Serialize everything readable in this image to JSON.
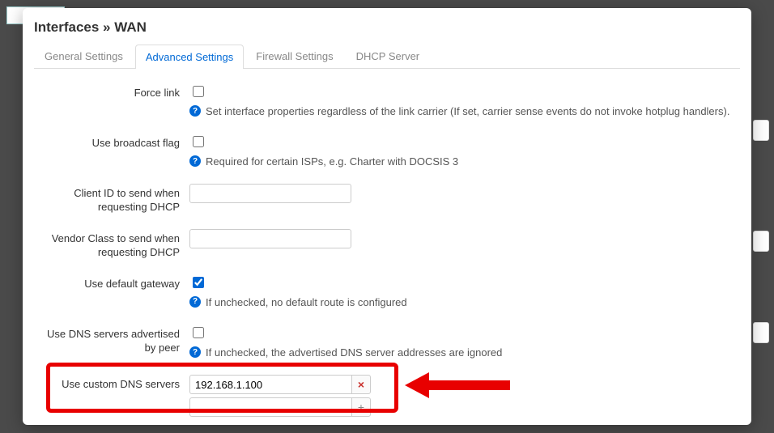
{
  "title": "Interfaces » WAN",
  "tabs": {
    "general": "General Settings",
    "advanced": "Advanced Settings",
    "firewall": "Firewall Settings",
    "dhcp": "DHCP Server"
  },
  "fields": {
    "force_link": {
      "label": "Force link",
      "help": "Set interface properties regardless of the link carrier (If set, carrier sense events do not invoke hotplug handlers)."
    },
    "broadcast_flag": {
      "label": "Use broadcast flag",
      "help": "Required for certain ISPs, e.g. Charter with DOCSIS 3"
    },
    "client_id": {
      "label": "Client ID to send when requesting DHCP"
    },
    "vendor_class": {
      "label": "Vendor Class to send when requesting DHCP"
    },
    "default_gateway": {
      "label": "Use default gateway",
      "help": "If unchecked, no default route is configured"
    },
    "dns_peer": {
      "label": "Use DNS servers advertised by peer",
      "help": "If unchecked, the advertised DNS server addresses are ignored"
    },
    "custom_dns": {
      "label": "Use custom DNS servers",
      "value": "192.168.1.100"
    }
  }
}
